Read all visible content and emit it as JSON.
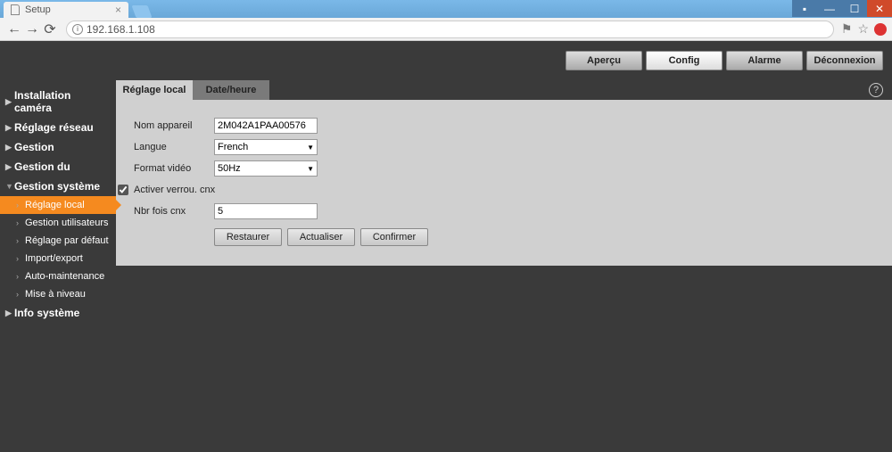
{
  "browser": {
    "tab_title": "Setup",
    "url": "192.168.1.108"
  },
  "header": {
    "buttons": {
      "preview": "Aperçu",
      "config": "Config",
      "alarm": "Alarme",
      "logout": "Déconnexion"
    }
  },
  "sidebar": {
    "install": "Installation caméra",
    "network": "Réglage réseau",
    "manage": "Gestion",
    "manage_du": "Gestion du",
    "system": "Gestion système",
    "subs": {
      "local": "Réglage local",
      "users": "Gestion utilisateurs",
      "defaults": "Réglage par défaut",
      "impexp": "Import/export",
      "automaint": "Auto-maintenance",
      "upgrade": "Mise à niveau"
    },
    "info": "Info système"
  },
  "tabs": {
    "local": "Réglage local",
    "datetime": "Date/heure"
  },
  "form": {
    "name_label": "Nom appareil",
    "name_value": "2M042A1PAA00576",
    "lang_label": "Langue",
    "lang_value": "French",
    "videofmt_label": "Format vidéo",
    "videofmt_value": "50Hz",
    "lock_checked": true,
    "lock_label": "Activer verrou. cnx",
    "count_label": "Nbr fois cnx",
    "count_value": "5",
    "buttons": {
      "restore": "Restaurer",
      "refresh": "Actualiser",
      "confirm": "Confirmer"
    }
  }
}
